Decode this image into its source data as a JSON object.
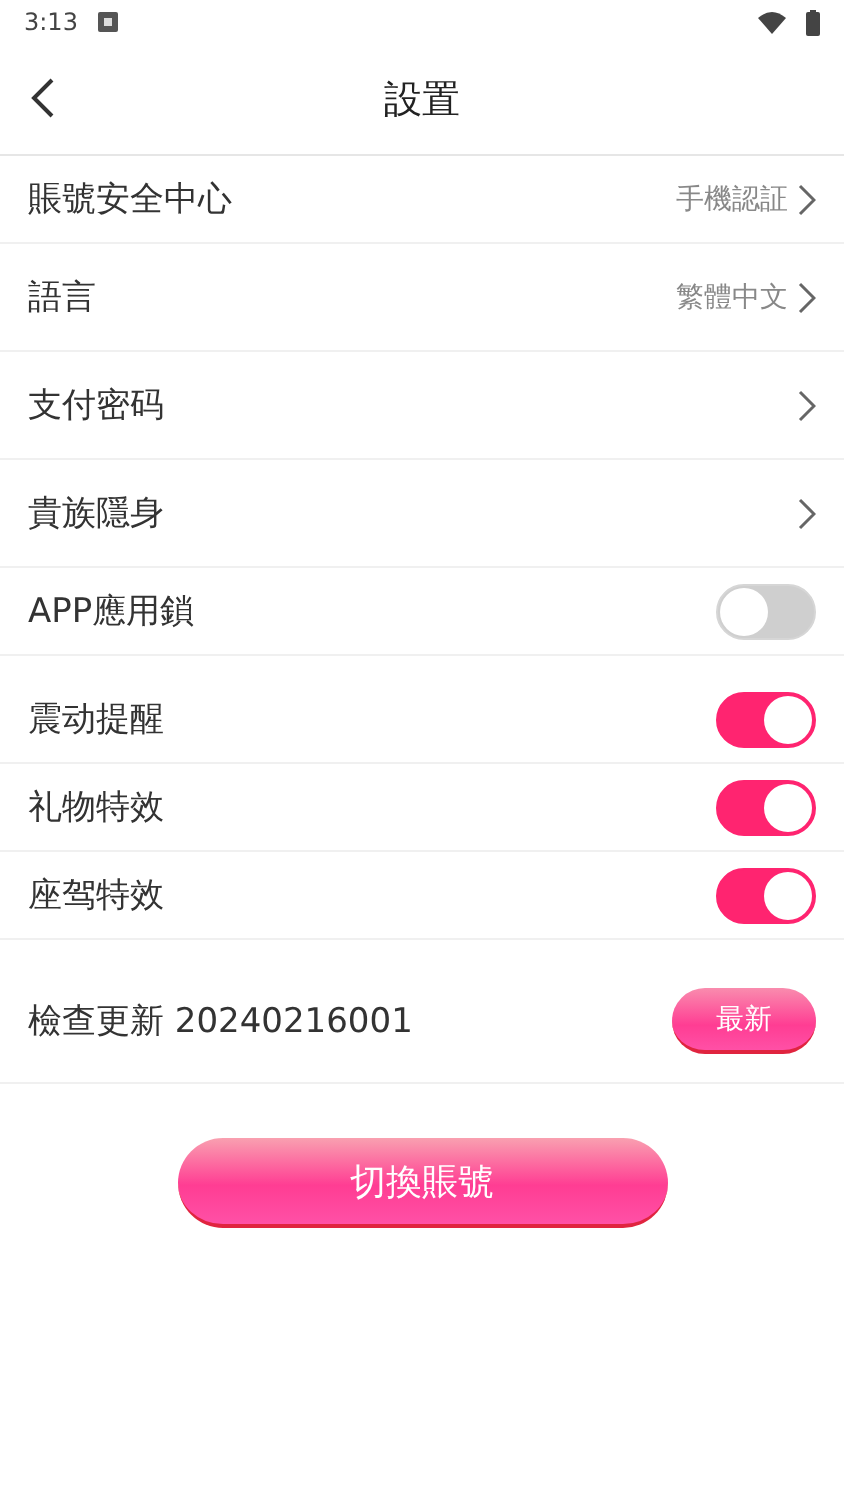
{
  "status_bar": {
    "time": "3:13"
  },
  "header": {
    "title": "設置"
  },
  "settings": [
    {
      "kind": "link",
      "label": "賬號安全中心",
      "value": "手機認証"
    },
    {
      "kind": "link",
      "label": "語言",
      "value": "繁體中文"
    },
    {
      "kind": "link",
      "label": "支付密码"
    },
    {
      "kind": "link",
      "label": "貴族隱身"
    },
    {
      "kind": "toggle",
      "label": "APP應用鎖",
      "on": false
    },
    {
      "kind": "gap"
    },
    {
      "kind": "toggle",
      "label": "震动提醒",
      "on": true
    },
    {
      "kind": "toggle",
      "label": "礼物特效",
      "on": true
    },
    {
      "kind": "toggle",
      "label": "座驾特效",
      "on": true
    }
  ],
  "update": {
    "label": "檢查更新 20240216001",
    "button": "最新"
  },
  "switch_account_button": "切換賬號"
}
